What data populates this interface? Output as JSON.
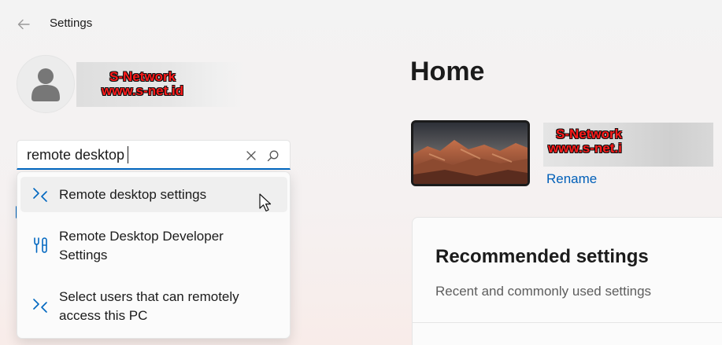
{
  "window": {
    "title": "Settings"
  },
  "account": {
    "watermark_lines": [
      "S-Network",
      "www.s-net.id"
    ]
  },
  "search": {
    "value": "remote desktop",
    "suggestions": [
      {
        "label": "Remote desktop settings",
        "icon": "remote-desktop-icon"
      },
      {
        "label": "Remote Desktop Developer Settings",
        "icon": "developer-tools-icon"
      },
      {
        "label": "Select users that can remotely access this PC",
        "icon": "remote-desktop-icon"
      }
    ]
  },
  "main": {
    "title": "Home",
    "device": {
      "watermark_lines": [
        "S-Network",
        "www.s-net.i"
      ],
      "rename_label": "Rename"
    },
    "recommended": {
      "title": "Recommended settings",
      "subtitle": "Recent and commonly used settings"
    }
  },
  "colors": {
    "accent": "#0067c0",
    "link": "#005fb8",
    "watermark": "#ff1a1a"
  }
}
